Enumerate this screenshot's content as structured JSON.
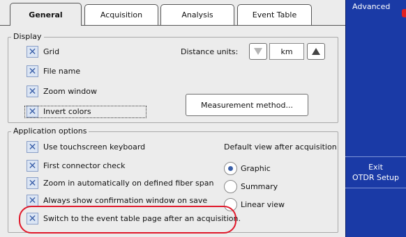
{
  "tabs": [
    {
      "label": "General",
      "active": true
    },
    {
      "label": "Acquisition",
      "active": false
    },
    {
      "label": "Analysis",
      "active": false
    },
    {
      "label": "Event Table",
      "active": false
    }
  ],
  "display": {
    "title": "Display",
    "checkboxes": [
      {
        "label": "Grid",
        "checked": true
      },
      {
        "label": "File name",
        "checked": true
      },
      {
        "label": "Zoom window",
        "checked": true
      },
      {
        "label": "Invert colors",
        "checked": true
      }
    ],
    "distance_units_label": "Distance units:",
    "distance_units_value": "km",
    "measurement_button": "Measurement method..."
  },
  "app_options": {
    "title": "Application options",
    "checkboxes": [
      {
        "label": "Use touchscreen keyboard",
        "checked": true
      },
      {
        "label": "First connector check",
        "checked": true
      },
      {
        "label": "Zoom in automatically on defined fiber span",
        "checked": true
      },
      {
        "label": "Always show confirmation window on save",
        "checked": true
      },
      {
        "label": "Switch to the event table page after an acquisition.",
        "checked": true
      }
    ],
    "default_view_label": "Default view after acquisition",
    "views": [
      {
        "label": "Graphic",
        "selected": true
      },
      {
        "label": "Summary",
        "selected": false
      },
      {
        "label": "Linear view",
        "selected": false
      }
    ]
  },
  "side_panel": {
    "title": "Advanced",
    "exit_line1": "Exit",
    "exit_line2": "OTDR Setup"
  },
  "colors": {
    "side_panel": "#1a3aa6",
    "highlight": "#e0182a",
    "check_mark": "#3a5fa8"
  }
}
